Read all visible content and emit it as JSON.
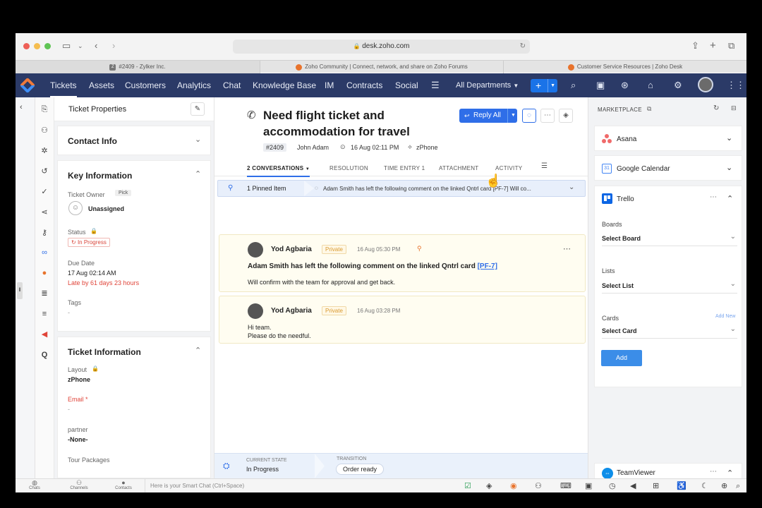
{
  "browser": {
    "url": "desk.zoho.com",
    "tabs": [
      {
        "label": "#2409 - Zylker Inc.",
        "icon": "zoho-z-icon"
      },
      {
        "label": "Zoho Community | Connect, network, and share on Zoho Forums",
        "icon": "zoho-community-icon"
      },
      {
        "label": "Customer Service Resources | Zoho Desk",
        "icon": "zoho-community-icon"
      }
    ]
  },
  "nav": {
    "items": [
      "Tickets",
      "Assets",
      "Customers",
      "Analytics",
      "Chat",
      "Knowledge Base",
      "IM",
      "Contracts",
      "Social"
    ],
    "active": "Tickets",
    "department": "All Departments",
    "colors": {
      "bar": "#2b3a67",
      "add_button": "#1a73e8"
    }
  },
  "props": {
    "title": "Ticket Properties",
    "contact_info": "Contact Info",
    "key_information": "Key Information",
    "ticket_owner_label": "Ticket Owner",
    "pick_label": "Pick",
    "owner_value": "Unassigned",
    "status_label": "Status",
    "status_value": "In Progress",
    "due_date_label": "Due Date",
    "due_date_value": "17 Aug 02:14 AM",
    "late_text": "Late by 61 days 23 hours",
    "tags_label": "Tags",
    "tags_value": "-",
    "ticket_information": "Ticket Information",
    "layout_label": "Layout",
    "layout_value": "zPhone",
    "email_label": "Email",
    "email_required": "*",
    "email_value": "-",
    "partner_label": "partner",
    "partner_value": "-None-",
    "tour_packages_label": "Tour Packages"
  },
  "ticket": {
    "subject_line1": "Need flight ticket and",
    "subject_line2": "accommodation for travel",
    "number": "#2409",
    "contact": "John Adam",
    "date": "16 Aug 02:11 PM",
    "channel": "zPhone",
    "reply_all": "Reply All",
    "tabs": [
      "2 CONVERSATIONS",
      "RESOLUTION",
      "TIME ENTRY 1",
      "ATTACHMENT",
      "ACTIVITY"
    ],
    "pinned_label": "1 Pinned Item",
    "pinned_text": "Adam Smith has left the following comment on the linked Qntrl card [PF-7] Will co..."
  },
  "messages": [
    {
      "author": "Yod Agbaria",
      "visibility": "Private",
      "time": "16 Aug 05:30 PM",
      "title": "Adam Smith has left the following comment on the linked Qntrl card",
      "link": "[PF-7]",
      "body": "Will confirm with the team for approval and get back."
    },
    {
      "author": "Yod Agbaria",
      "visibility": "Private",
      "time": "16 Aug 03:28 PM",
      "line1": "Hi team.",
      "line2": "Please do the needful."
    }
  ],
  "state": {
    "current_label": "CURRENT STATE",
    "current_value": "In Progress",
    "transition_label": "TRANSITION",
    "transition_value": "Order ready"
  },
  "marketplace": {
    "title": "MARKETPLACE",
    "apps": [
      "Asana",
      "Google Calendar",
      "Trello",
      "TeamViewer"
    ],
    "trello": {
      "boards_label": "Boards",
      "boards_value": "Select Board",
      "lists_label": "Lists",
      "lists_value": "Select List",
      "cards_label": "Cards",
      "cards_add_new": "Add New",
      "cards_value": "Select Card",
      "add_button": "Add"
    }
  },
  "bottom": {
    "items": [
      "Chats",
      "Channels",
      "Contacts"
    ],
    "smart_chat_placeholder": "Here is your Smart Chat (Ctrl+Space)"
  }
}
